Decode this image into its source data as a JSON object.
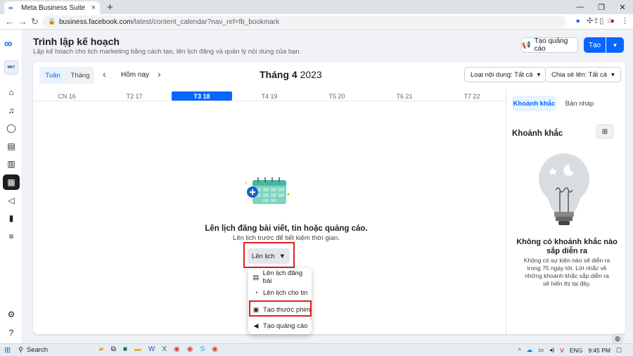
{
  "browser": {
    "tab_title": "Meta Business Suite",
    "tab_close": "×",
    "new_tab": "+",
    "url_main": "business.facebook.com",
    "url_rest": "/latest/content_calendar?nav_ref=fb_bookmark",
    "window_controls": [
      "—",
      "❐",
      "✕"
    ]
  },
  "header": {
    "title": "Trình lập kế hoạch",
    "subtitle": "Lập kế hoạch cho lịch marketing bằng cách tạo, lên lịch đăng và quản lý nội dung của bạn.",
    "create_ad_label": "Tạo quảng cáo",
    "create_label": "Tạo"
  },
  "rail": {
    "page_badge": "MKT"
  },
  "calendar": {
    "view_week": "Tuần",
    "view_month": "Tháng",
    "today": "Hôm nay",
    "month_name": "Tháng 4",
    "year": "2023",
    "filter_content": "Loại nội dung: Tất cả",
    "filter_shared": "Chia sẻ lên: Tất cả",
    "days": [
      "CN 16",
      "T2 17",
      "T3 18",
      "T4 19",
      "T5 20",
      "T6 21",
      "T7 22"
    ],
    "selected_day_index": 2
  },
  "empty_state": {
    "title": "Lên lịch đăng bài viết, tin hoặc quảng cáo.",
    "subtitle": "Lên lịch trước để tiết kiệm thời gian.",
    "button": "Lên lịch"
  },
  "menu": {
    "items": [
      {
        "label": "Lên lịch đăng bài",
        "icon": "post-icon"
      },
      {
        "label": "Lên lịch cho tin",
        "icon": "story-icon"
      },
      {
        "label": "Tạo thước phim",
        "icon": "reel-icon"
      },
      {
        "label": "Tạo quảng cáo",
        "icon": "megaphone-icon"
      }
    ]
  },
  "right_panel": {
    "tab_moments": "Khoảnh khắc",
    "tab_drafts": "Bản nháp",
    "section_title": "Khoảnh khắc",
    "empty_title": "Không có khoảnh khắc nào sắp diễn ra",
    "empty_sub": "Không có sự kiện nào sẽ diễn ra trong 75 ngày tới. Lời nhắc về những khoảnh khắc sắp diễn ra sẽ hiển thị tại đây."
  },
  "taskbar": {
    "search": "Search",
    "lang": "ENG",
    "time": "9:45 PM"
  },
  "colors": {
    "accent": "#0866ff",
    "highlight": "#e41e1e"
  }
}
